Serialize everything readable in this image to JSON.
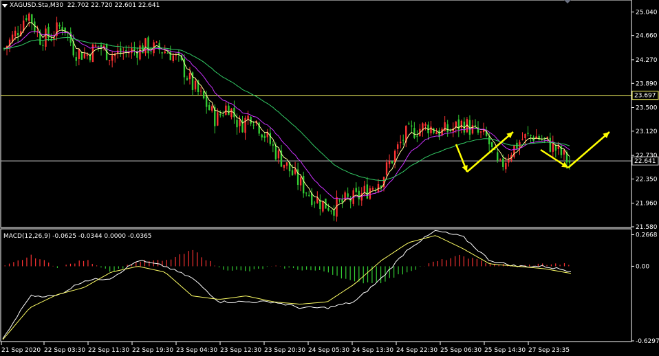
{
  "main_panel": {
    "title": "XAGUSD.Sta,M30",
    "ohlc": "22.702 22.720 22.601 22.641",
    "price_ticks": [
      "25.040",
      "24.660",
      "24.270",
      "23.890",
      "23.500",
      "23.120",
      "22.730",
      "22.350",
      "21.960",
      "21.580"
    ],
    "h_lines": [
      {
        "price_label": "23.697",
        "color": "#ffff66"
      },
      {
        "price_label": "22.641",
        "color": "#cccccc"
      }
    ]
  },
  "macd_panel": {
    "title": "MACD(12,26,9)",
    "values": "-0.0625 -0.0344 0.0000 -0.0365",
    "ticks": [
      "0.2668",
      "0.00",
      "-0.6297"
    ]
  },
  "time_axis": [
    "21 Sep 2020",
    "22 Sep 03:30",
    "22 Sep 11:30",
    "22 Sep 19:30",
    "23 Sep 04:30",
    "23 Sep 12:30",
    "23 Sep 20:30",
    "24 Sep 05:30",
    "24 Sep 13:30",
    "24 Sep 22:30",
    "25 Sep 06:30",
    "25 Sep 14:30",
    "27 Sep 23:35"
  ],
  "colors": {
    "bull": "#ff3333",
    "bear": "#33cc33",
    "ma_fast": "#ffff99",
    "ma_mid": "#cc33ff",
    "ma_slow": "#33cc66",
    "macd_line": "#ffffff",
    "signal_line": "#ffff66",
    "annot": "#ffff00",
    "axis": "#ffffff"
  },
  "chart_data": {
    "type": "candlestick",
    "symbol": "XAGUSD.Sta",
    "timeframe": "M30",
    "ylim": [
      21.58,
      25.21
    ],
    "close_path": [
      24.45,
      24.7,
      25.05,
      24.62,
      24.65,
      24.85,
      24.4,
      24.35,
      24.5,
      24.35,
      24.38,
      24.42,
      24.48,
      24.44,
      24.4,
      24.2,
      23.85,
      23.6,
      23.3,
      23.55,
      23.2,
      23.4,
      23.1,
      22.8,
      22.55,
      22.3,
      22.1,
      21.95,
      21.9,
      22.0,
      22.05,
      22.2,
      22.35,
      22.7,
      23.05,
      23.15,
      23.2,
      23.1,
      23.15,
      23.25,
      23.1,
      23.0,
      22.5,
      22.8,
      23.0,
      23.05,
      22.95,
      22.8,
      22.62
    ],
    "macd_ylim": [
      -0.6297,
      0.31
    ],
    "macd_line_path": [
      -0.62,
      -0.25,
      -0.25,
      -0.12,
      -0.1,
      0.05,
      0.0,
      -0.1,
      -0.3,
      -0.3,
      -0.3,
      -0.35,
      -0.35,
      -0.3,
      -0.1,
      0.15,
      0.3,
      0.25,
      0.05,
      0.0,
      0.0,
      -0.04
    ],
    "signal_line_path": [
      -0.62,
      -0.35,
      -0.24,
      -0.18,
      -0.05,
      0.0,
      -0.05,
      -0.25,
      -0.28,
      -0.25,
      -0.3,
      -0.32,
      -0.3,
      -0.15,
      0.05,
      0.2,
      0.26,
      0.15,
      0.02,
      0.0,
      -0.02,
      -0.06
    ]
  }
}
